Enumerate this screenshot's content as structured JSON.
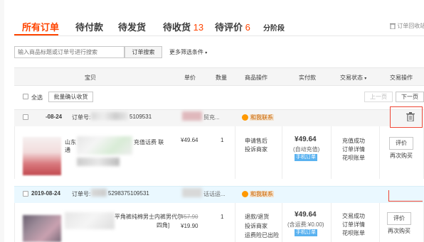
{
  "tabs": [
    {
      "label": "所有订单",
      "count": ""
    },
    {
      "label": "待付款",
      "count": ""
    },
    {
      "label": "待发货",
      "count": ""
    },
    {
      "label": "待收货",
      "count": "13"
    },
    {
      "label": "待评价",
      "count": "6"
    },
    {
      "label": "分阶段",
      "count": ""
    }
  ],
  "recycle_label": "订单回收站",
  "search": {
    "placeholder": "输入商品标题或订单号进行搜索",
    "button": "订单搜索",
    "more_filters": "更多筛选条件"
  },
  "table_headers": [
    "宝贝",
    "单价",
    "数量",
    "商品操作",
    "实付款",
    "交易状态",
    "交易操作"
  ],
  "select_all": "全选",
  "batch_confirm": "批量确认收货",
  "prev_page": "上一页",
  "next_page": "下一页",
  "orders": [
    {
      "date": "-08-24",
      "order_no_label": "订单号:",
      "order_no": "5109531",
      "shop_partial": "贸充...",
      "contact": "和我联系",
      "item_title_a": "山东",
      "item_title_b": "充值话费 联",
      "item_title_c": "通",
      "unit_price": "¥49.64",
      "quantity": "1",
      "item_ops": [
        "申请售后",
        "投诉商家"
      ],
      "paid": "¥49.64",
      "paid_note": "(自动充值)",
      "paid_tag": "手机订单",
      "status": [
        "充值成功",
        "订单详情",
        "花呗账单"
      ],
      "action_button": "评价",
      "action_link": "再次购买",
      "icons": {
        "contact": "wangwang-icon",
        "delete": "trash-icon",
        "alert": "exclamation-icon",
        "chevron": "chevron-down-icon",
        "recycle": "recycle-bin-icon"
      }
    },
    {
      "date": "2019-08-24",
      "order_no_label": "订单号:",
      "order_no": "5298375109531",
      "shop_partial": "话话运...",
      "contact": "和我联系",
      "item_title_a": "...",
      "item_title_b": "平角裤纯棉男士内裤男代尔",
      "item_title_c": "四角]",
      "original_price": "¥57.90",
      "unit_price": "¥19.90",
      "quantity": "1",
      "item_ops": [
        "退款/退货",
        "投诉商家",
        "运费险已出险"
      ],
      "paid": "¥49.64",
      "paid_note": "(含运费:¥0.00)",
      "paid_tag": "手机订单",
      "status": [
        "交易成功",
        "订单详情",
        "花呗账单"
      ],
      "action_button": "评价",
      "action_link": "再次购买"
    }
  ],
  "colors": {
    "accent": "#f40",
    "header_bg": "#f5f5f5",
    "blue_row": "#eaf8ff",
    "tag_blue": "#5ab2f0"
  }
}
